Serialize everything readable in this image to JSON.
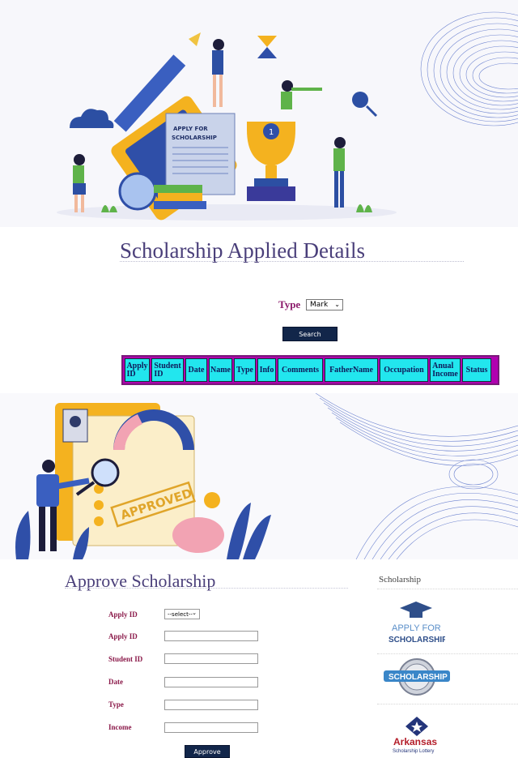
{
  "search_section": {
    "title": "Scholarship Applied Details",
    "type_label": "Type",
    "type_select_value": "Mark",
    "search_label": "Search",
    "illustration_text": "APPLY FOR SCHOLARSHIP",
    "table_headers": [
      [
        "Apply",
        "ID"
      ],
      [
        "Student",
        "ID"
      ],
      [
        "Date"
      ],
      [
        "Name"
      ],
      [
        "Type"
      ],
      [
        "Info"
      ],
      [
        "Comments"
      ],
      [
        "FatherName"
      ],
      [
        "Occupation"
      ],
      [
        "Anual",
        "Income"
      ],
      [
        "Status"
      ]
    ]
  },
  "approve_section": {
    "title": "Approve Scholarship",
    "illustration_text": "APPROVED",
    "apply_select_label": "Apply ID",
    "apply_select_value": "--select--",
    "fields": [
      {
        "label": "Apply ID",
        "value": ""
      },
      {
        "label": "Student ID",
        "value": ""
      },
      {
        "label": "Date",
        "value": ""
      },
      {
        "label": "Type",
        "value": ""
      },
      {
        "label": "Income",
        "value": ""
      }
    ],
    "approve_label": "Approve"
  },
  "sidebar": {
    "title": "Scholarship",
    "logos": [
      {
        "line1": "APPLY FOR",
        "line2": "SCHOLARSHIPS"
      },
      {
        "line1": "SCHOLARSHIP"
      },
      {
        "line1": "Arkansas",
        "line2": "Scholarship Lottery"
      }
    ]
  },
  "colors": {
    "title": "#4a3f7a",
    "label": "#8b1a4a",
    "button": "#12264a",
    "grid_header": "#22e6ee",
    "grid_border": "#b000b0"
  }
}
